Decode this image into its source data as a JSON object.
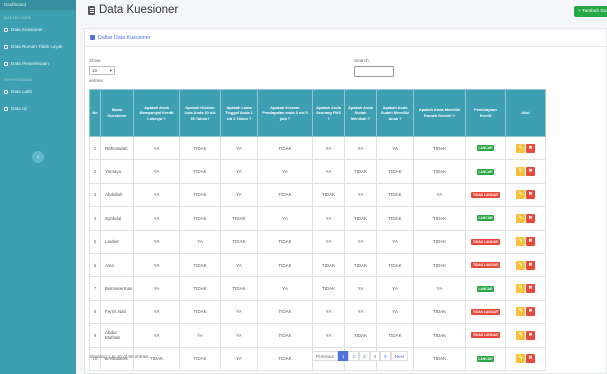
{
  "sidebar": {
    "top_label": "Dashboard",
    "sections": [
      {
        "heading": "MASTER DATA",
        "items": [
          {
            "label": "Data Kuesioner",
            "icon": "list-icon"
          },
          {
            "label": "Data Rumah Tidak Layak",
            "icon": "home-icon"
          },
          {
            "label": "Data Pemeriksaan",
            "icon": "file-icon"
          }
        ]
      },
      {
        "heading": "PERHITUNGAN",
        "items": [
          {
            "label": "Data Latih",
            "icon": "table-icon"
          },
          {
            "label": "Data Uji",
            "icon": "chart-icon"
          }
        ]
      }
    ],
    "toggle_glyph": "‹"
  },
  "header": {
    "title": "Data Kuesioner",
    "add_button": "+ Tambah Data"
  },
  "card": {
    "title": "Daftar Data Kuesioner",
    "show_label": "Show",
    "entries_value": "10",
    "entries_label": "entries",
    "search_label": "Search:"
  },
  "table": {
    "headers": [
      "No",
      "Nama Kuesioner",
      "Apakah Anda Mempunyai Kredit Lainnya ?",
      "Apakah Kisaran Usia Anda 20 s/d 35 Tahun?",
      "Apakah Lama Tinggal Anda 1 s/d 2 Tahun ?",
      "Apakah Kisaran Pendapatan anda 3 s/d 5 juta ?",
      "Apakah Anda Seorang PNS ?",
      "Apakah Anda Sudah Menikah ?",
      "Apakah Anda Sudah Memiliki Anak ?",
      "Apakah Anda Memiliki Rumah Sendiri ?",
      "Pembiayaan Kredit",
      "Aksi"
    ],
    "rows": [
      {
        "no": "1",
        "name": "Rahmawati",
        "c": [
          "YA",
          "TIDAK",
          "YA",
          "TIDAK",
          "YA",
          "YA",
          "YA",
          "TIDAK"
        ],
        "status": "LANCAR",
        "ok": true
      },
      {
        "no": "2",
        "name": "Yamayo",
        "c": [
          "YA",
          "TIDAK",
          "YA",
          "YA",
          "YA",
          "TIDAK",
          "TIDAK",
          "TIDAK"
        ],
        "status": "LANCAR",
        "ok": true
      },
      {
        "no": "3",
        "name": "Abdullah",
        "c": [
          "YA",
          "TIDAK",
          "YA",
          "TIDAK",
          "TIDAK",
          "YA",
          "TIDAK",
          "YA"
        ],
        "status": "TIDAK LANCAR",
        "ok": false
      },
      {
        "no": "4",
        "name": "Syahdul",
        "c": [
          "YA",
          "TIDAK",
          "TIDAK",
          "YA",
          "YA",
          "TIDAK",
          "TIDAK",
          "TIDAK"
        ],
        "status": "LANCAR",
        "ok": true
      },
      {
        "no": "5",
        "name": "Leuber",
        "c": [
          "YA",
          "YA",
          "TIDAK",
          "TIDAK",
          "YA",
          "YA",
          "YA",
          "TIDAK"
        ],
        "status": "TIDAK LANCAR",
        "ok": false
      },
      {
        "no": "6",
        "name": "Asia",
        "c": [
          "YA",
          "TIDAK",
          "YA",
          "TIDAK",
          "TIDAK",
          "TIDAK",
          "TIDAK",
          "TIDAK"
        ],
        "status": "TIDAK LANCAR",
        "ok": false
      },
      {
        "no": "7",
        "name": "Bismaserman",
        "c": [
          "YA",
          "TIDAK",
          "TIDAK",
          "YA",
          "TIDAK",
          "YA",
          "YA",
          "YA"
        ],
        "status": "LANCAR",
        "ok": true
      },
      {
        "no": "8",
        "name": "Ferris Nati",
        "c": [
          "YA",
          "TIDAK",
          "YA",
          "TIDAK",
          "YA",
          "YA",
          "YA",
          "TIDAK"
        ],
        "status": "TIDAK LANCAR",
        "ok": false
      },
      {
        "no": "9",
        "name": "Abdul Muthab",
        "c": [
          "YA",
          "YA",
          "YA",
          "TIDAK",
          "YA",
          "TIDAK",
          "TIDAK",
          "TIDAK"
        ],
        "status": "TIDAK LANCAR",
        "ok": false
      },
      {
        "no": "10",
        "name": "ar Mubarek",
        "c": [
          "TIDAK",
          "TIDAK",
          "YA",
          "TIDAK",
          "YA",
          "YA",
          "TIDAK",
          "TIDAK"
        ],
        "status": "LANCAR",
        "ok": true
      }
    ],
    "edit_glyph": "✎",
    "delete_glyph": "✖"
  },
  "footer": {
    "info": "Showing 1 to 10 of 50 entries",
    "pages": [
      "Previous",
      "1",
      "2",
      "3",
      "4",
      "5",
      "Next"
    ],
    "active_page": "1"
  },
  "colors": {
    "sidebar": "#3d9fb1",
    "header_row": "#3e9fb3",
    "lancar": "#28a745",
    "tidak_lancar": "#e74a3b",
    "edit": "#f6c23e",
    "primary": "#4e73df"
  }
}
